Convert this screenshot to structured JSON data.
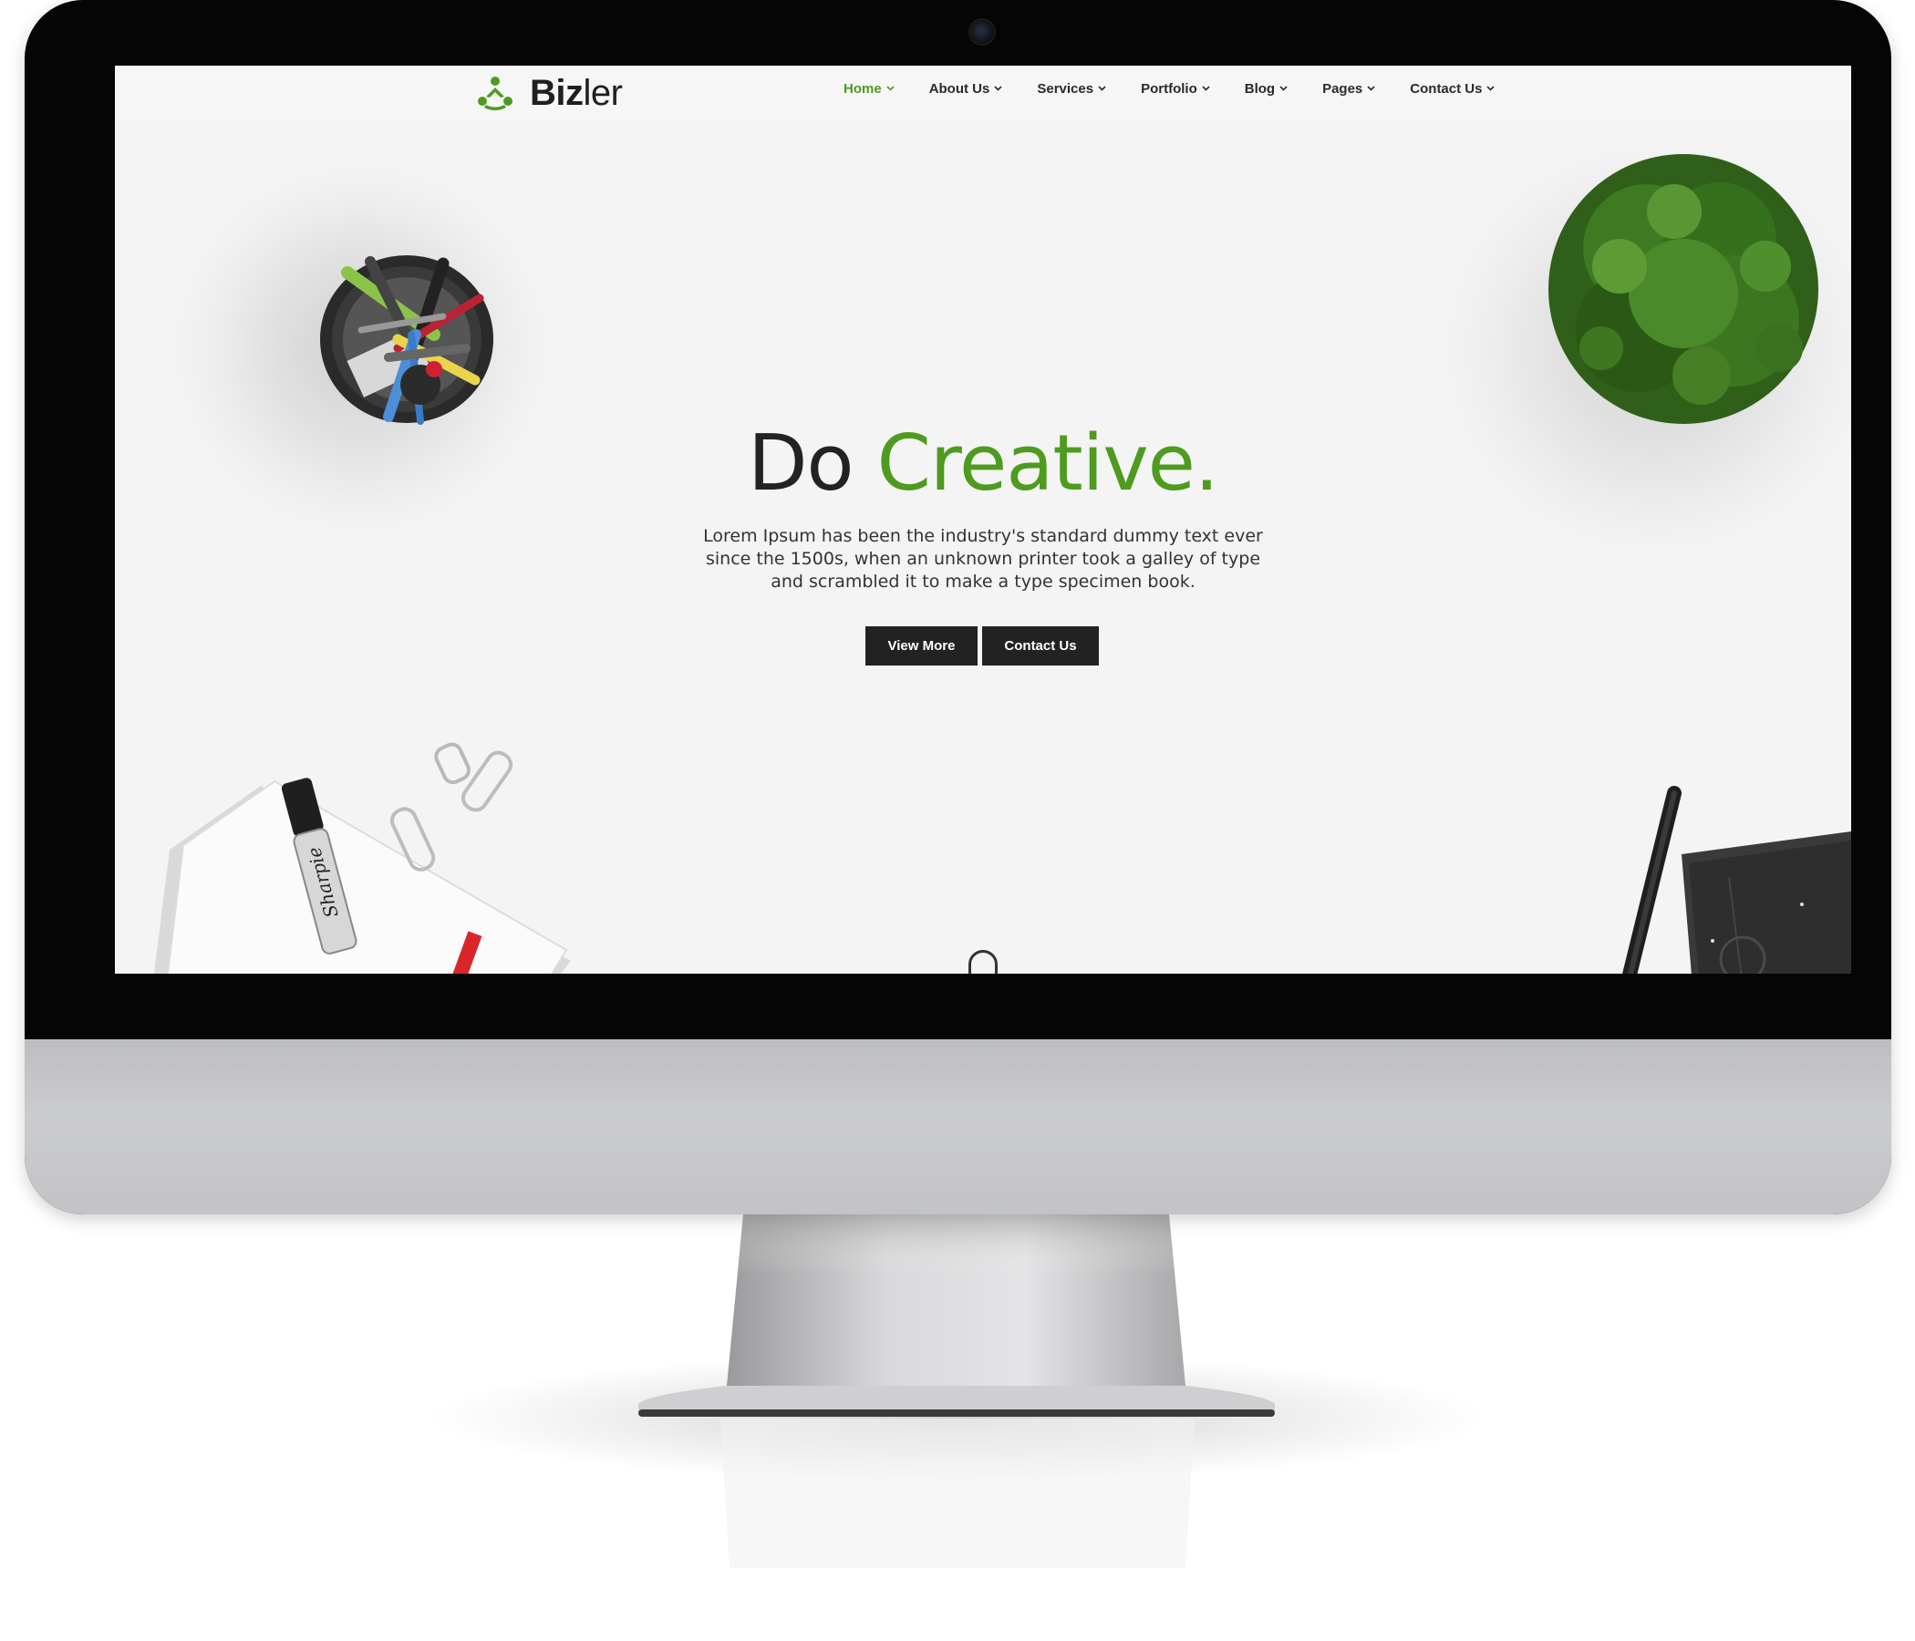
{
  "brand": {
    "name_bold": "Biz",
    "name_light": "ler",
    "accent_color": "#4e9b1f",
    "logo_icon": "people-cluster-icon"
  },
  "nav": {
    "items": [
      {
        "label": "Home",
        "active": true
      },
      {
        "label": "About Us",
        "active": false
      },
      {
        "label": "Services",
        "active": false
      },
      {
        "label": "Portfolio",
        "active": false
      },
      {
        "label": "Blog",
        "active": false
      },
      {
        "label": "Pages",
        "active": false
      },
      {
        "label": "Contact Us",
        "active": false
      }
    ],
    "dropdown_icon": "chevron-down-icon"
  },
  "hero": {
    "title_plain": "Do",
    "title_accent": "Creative.",
    "description": "Lorem Ipsum has been the industry's standard dummy text ever since the 1500s, when an unknown printer took a galley of type and scrambled it to make a type specimen book.",
    "primary_button": "View More",
    "secondary_button": "Contact Us",
    "scroll_icon": "mouse-scroll-icon"
  },
  "desk_items": {
    "marker_label": "Sharpie"
  },
  "colors": {
    "screen_background": "#f4f4f4",
    "button_background": "#222222",
    "monitor_bezel": "#050505",
    "monitor_chin": "#c4c5c8"
  }
}
